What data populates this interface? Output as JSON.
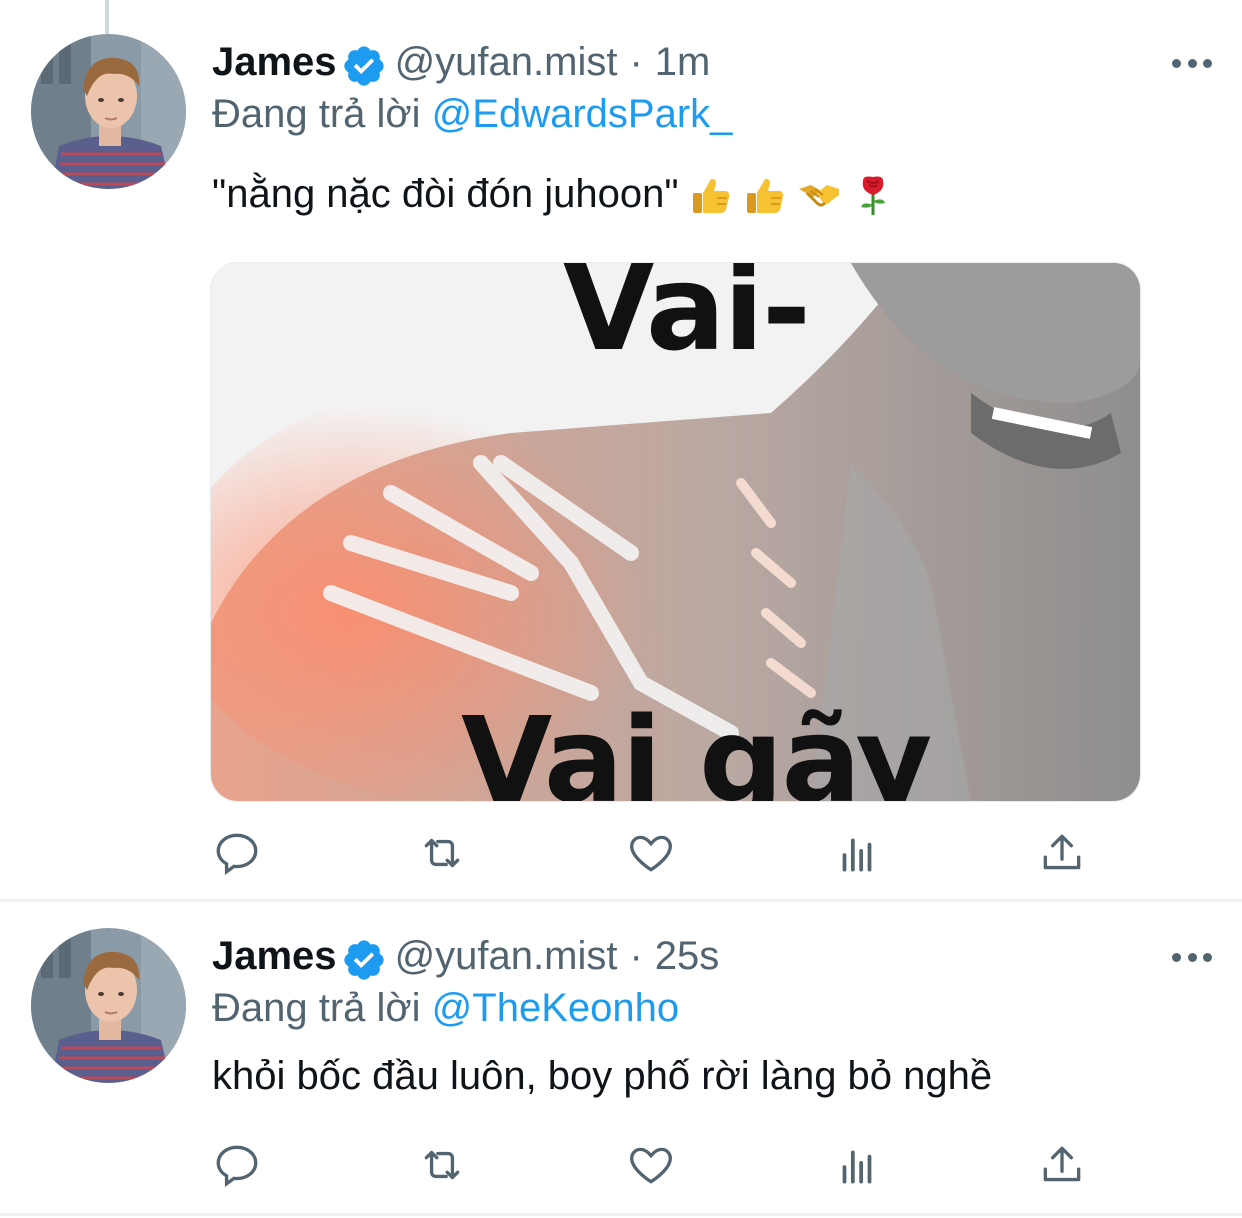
{
  "colors": {
    "accent": "#1d9bf0",
    "text": "#0f1419",
    "secondary": "#536471",
    "divider": "#eff3f4"
  },
  "tweets": [
    {
      "author": {
        "name": "James",
        "handle": "@yufan.mist",
        "verified": true,
        "avatar": "profile-photo"
      },
      "separator": "·",
      "time": "1m",
      "replying": {
        "prefix": "Đang trả lời",
        "mention": "@EdwardsPark_"
      },
      "text": "\"nằng nặc đòi đón juhoon\"",
      "emojis": [
        "thumbs-up",
        "thumbs-up",
        "handshake",
        "rose"
      ],
      "media": {
        "type": "image",
        "caption_top": "Vai-",
        "caption_bottom": "Vai gãy"
      },
      "actions": [
        "reply-icon",
        "retweet-icon",
        "like-icon",
        "views-icon",
        "share-icon"
      ]
    },
    {
      "author": {
        "name": "James",
        "handle": "@yufan.mist",
        "verified": true,
        "avatar": "profile-photo"
      },
      "separator": "·",
      "time": "25s",
      "replying": {
        "prefix": "Đang trả lời",
        "mention": "@TheKeonho"
      },
      "text": "khỏi bốc đầu luôn, boy phố rời làng bỏ nghề",
      "actions": [
        "reply-icon",
        "retweet-icon",
        "like-icon",
        "views-icon",
        "share-icon"
      ]
    }
  ]
}
